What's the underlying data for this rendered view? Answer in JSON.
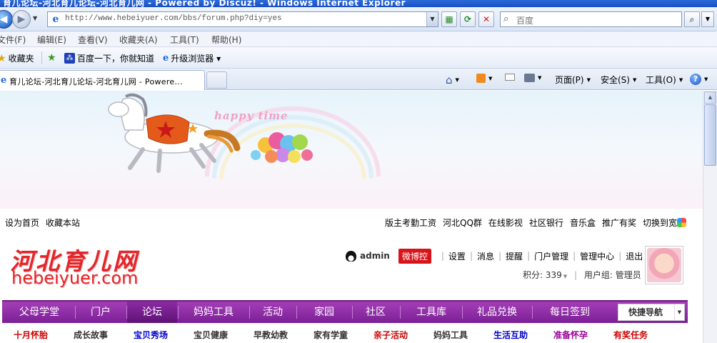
{
  "window": {
    "title": "育儿论坛-河北育儿论坛-河北育儿网 - Powered by Discuz! - Windows Internet Explorer"
  },
  "address": {
    "url": "http://www.hebeiyuer.com/bbs/forum.php?diy=yes",
    "search_placeholder": "百度"
  },
  "menu": [
    "文件(F)",
    "编辑(E)",
    "查看(V)",
    "收藏夹(A)",
    "工具(T)",
    "帮助(H)"
  ],
  "favorites": {
    "favorites_label": "收藏夹",
    "items": [
      "百度一下，你就知道",
      "升级浏览器 ▾"
    ]
  },
  "tab": {
    "title": "育儿论坛-河北育儿论坛-河北育儿网 - Powere..."
  },
  "commands": {
    "page": "页面(P)",
    "safety": "安全(S)",
    "tools": "工具(O)"
  },
  "site": {
    "banner_text": "happy time",
    "topbar_left": [
      "设为首页",
      "收藏本站"
    ],
    "topbar_right": [
      "版主考勤工资",
      "河北QQ群",
      "在线影视",
      "社区银行",
      "音乐盒",
      "推广有奖",
      "切换到宽版"
    ],
    "logo_cn": "河北育儿网",
    "logo_en": "hebeiyuer.com",
    "user": {
      "name": "admin",
      "weibo": "微博控",
      "links": [
        "设置",
        "消息",
        "提醒",
        "门户管理",
        "管理中心",
        "退出"
      ],
      "score_label": "积分: 339",
      "group_label": "用户组: 管理员"
    },
    "nav": [
      "父母学堂",
      "门户",
      "论坛",
      "妈妈工具",
      "活动",
      "家园",
      "社区",
      "工具库",
      "礼品兑换",
      "每日签到"
    ],
    "quick_nav": "快捷导航",
    "subnav": [
      {
        "label": "十月怀胎",
        "color": "#cc0000"
      },
      {
        "label": "成长故事",
        "color": "#333333"
      },
      {
        "label": "宝贝秀场",
        "color": "#0000cc"
      },
      {
        "label": "宝贝健康",
        "color": "#333333"
      },
      {
        "label": "早教幼教",
        "color": "#333333"
      },
      {
        "label": "家有学童",
        "color": "#333333"
      },
      {
        "label": "亲子活动",
        "color": "#cc0000"
      },
      {
        "label": "妈妈工具",
        "color": "#333333"
      },
      {
        "label": "生活互助",
        "color": "#0000cc"
      },
      {
        "label": "准备怀孕",
        "color": "#990099"
      },
      {
        "label": "有奖任务",
        "color": "#cc0000"
      }
    ]
  }
}
